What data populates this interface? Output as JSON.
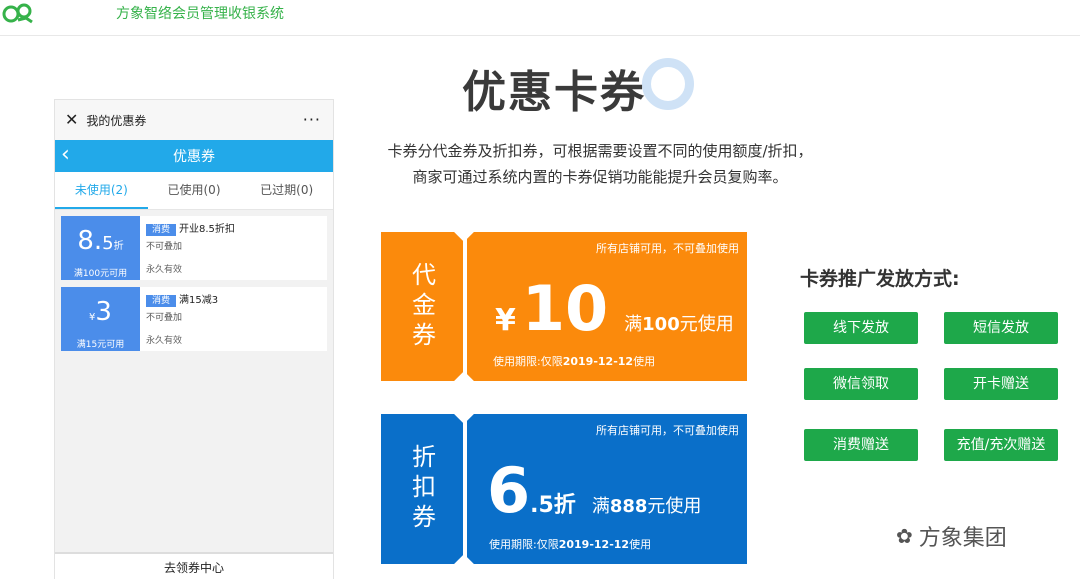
{
  "app": {
    "title": "方象智络会员管理收银系统"
  },
  "phone": {
    "title": "我的优惠券",
    "nav_title": "优惠券",
    "tabs": [
      "未使用(2)",
      "已使用(0)",
      "已过期(0)"
    ],
    "coupons": [
      {
        "value_main": "8.",
        "value_small": "5",
        "value_unit": "折",
        "condition": "满100元可用",
        "tag": "消费",
        "name": "开业8.5折扣",
        "stack": "不可叠加",
        "valid": "永久有效"
      },
      {
        "value_prefix": "¥",
        "value_main": "3",
        "condition": "满15元可用",
        "tag": "消费",
        "name": "满15减3",
        "stack": "不可叠加",
        "valid": "永久有效"
      }
    ],
    "footer": "去领券中心"
  },
  "heading": "优惠卡券",
  "description": [
    "卡券分代金券及折扣券，可根据需要设置不同的使用额度/折扣，",
    "商家可通过系统内置的卡券促销功能能提升会员复购率。"
  ],
  "coupon_cards": [
    {
      "type": "代金券",
      "top_note": "所有店铺可用，不可叠加使用",
      "yen": "¥",
      "value": "10",
      "cond_prefix": "满",
      "cond_amount": "100",
      "cond_suffix": "元使用",
      "date_prefix": "使用期限:仅限",
      "date": "2019-12-12",
      "date_suffix": "使用",
      "color": "#fb8a0c"
    },
    {
      "type": "折扣券",
      "top_note": "所有店铺可用，不可叠加使用",
      "value": "6",
      "value_small": ".5折",
      "cond_prefix": "满",
      "cond_amount": "888",
      "cond_suffix": "元使用",
      "date_prefix": "使用期限:仅限",
      "date": "2019-12-12",
      "date_suffix": "使用",
      "color": "#0a6fc9"
    }
  ],
  "methods": {
    "title": "卡券推广发放方式:",
    "buttons": [
      "线下发放",
      "短信发放",
      "微信领取",
      "开卡赠送",
      "消费赠送",
      "充值/充次赠送"
    ],
    "color": "#1ea84a"
  },
  "watermark": {
    "text": "方象集团",
    "icon": "wechat-icon"
  }
}
